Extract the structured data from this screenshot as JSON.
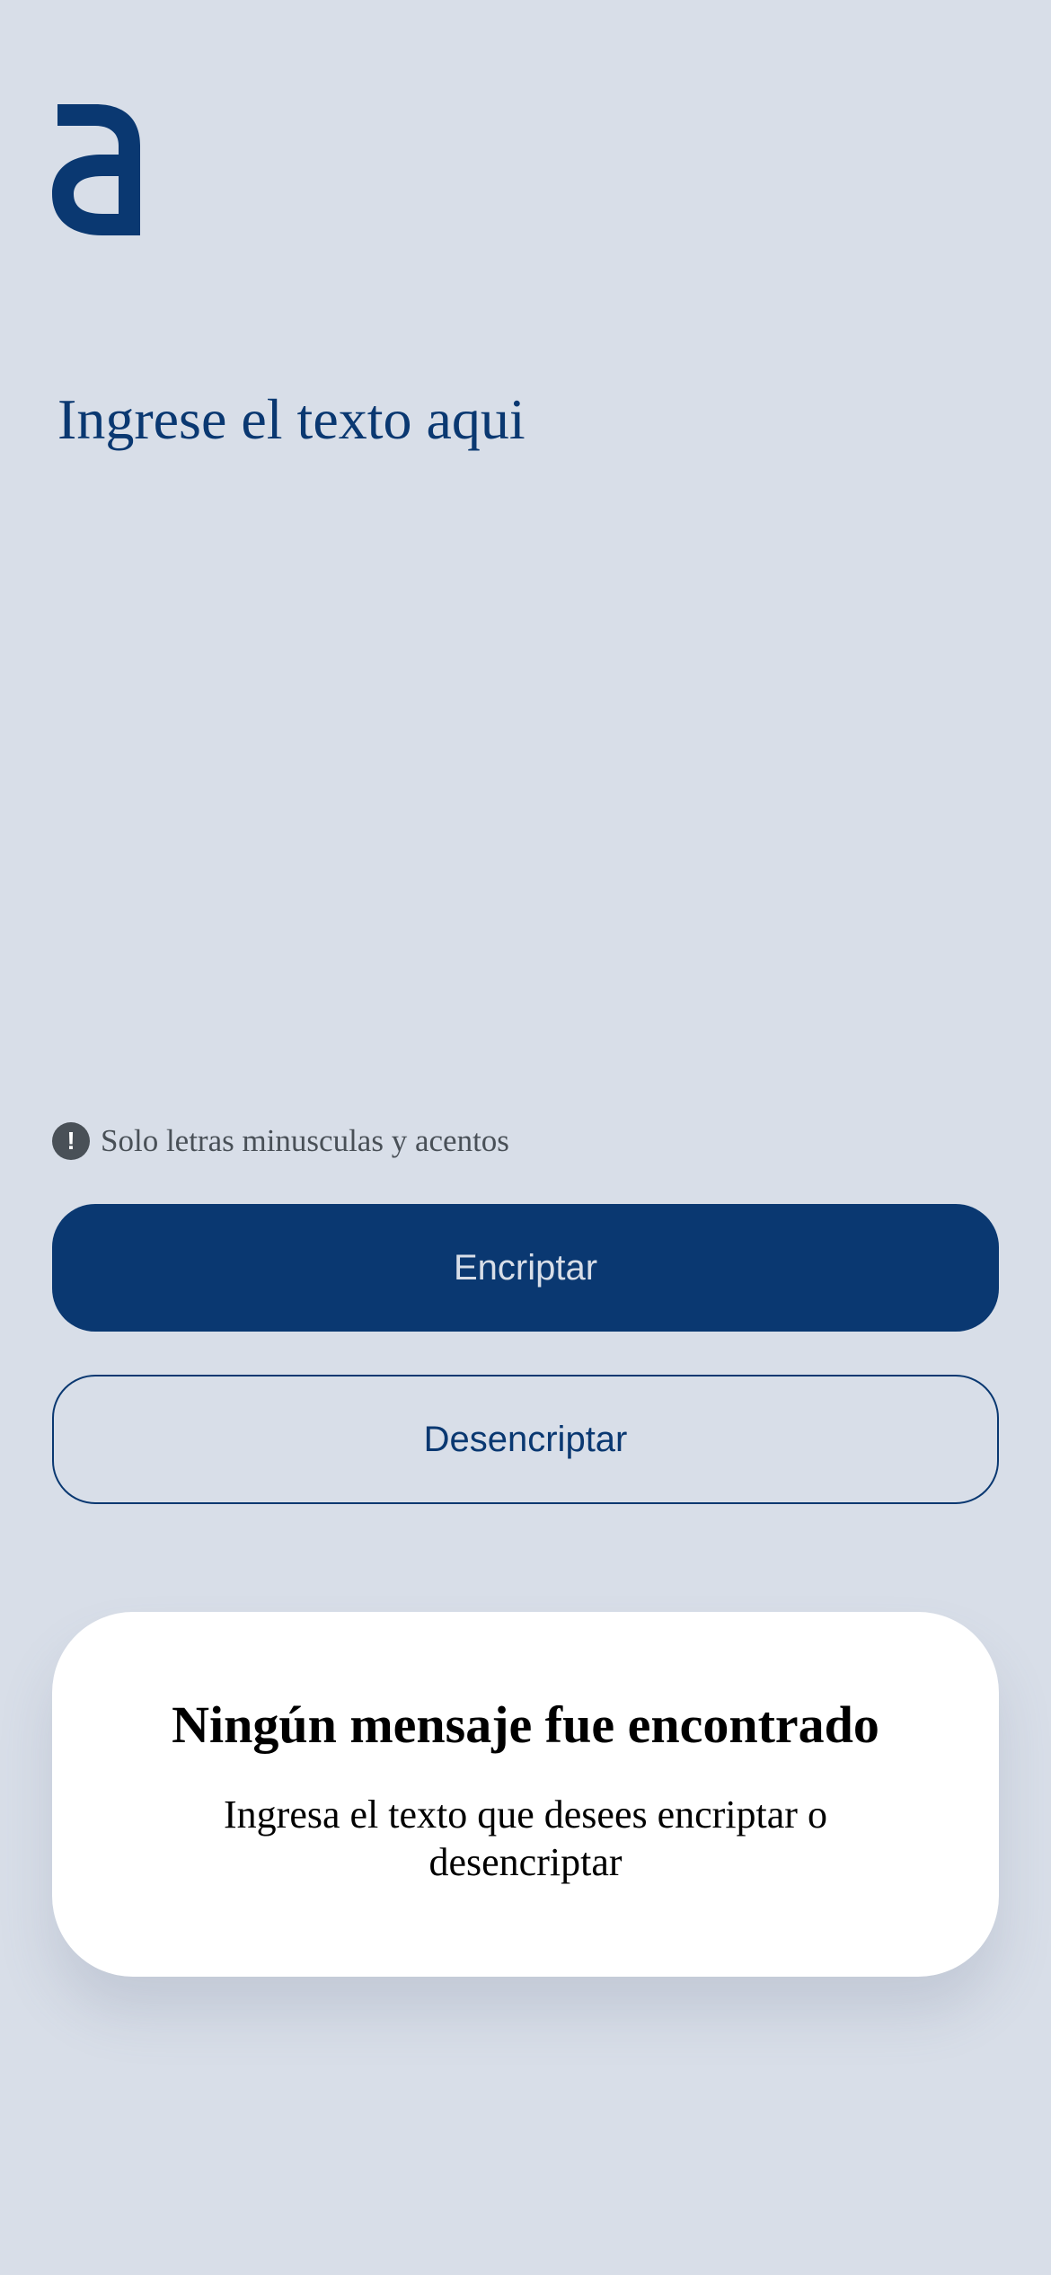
{
  "brand": {
    "logo_icon": "alura-a-logo-icon",
    "color": "#0a3871"
  },
  "input": {
    "placeholder": "Ingrese el texto aqui",
    "value": ""
  },
  "hint": {
    "icon": "exclamation-circle-icon",
    "text": "Solo letras minusculas y acentos"
  },
  "buttons": {
    "encrypt_label": "Encriptar",
    "decrypt_label": "Desencriptar"
  },
  "result": {
    "title": "Ningún mensaje fue encontrado",
    "message": "Ingresa el texto que desees encriptar o desencriptar"
  },
  "colors": {
    "background": "#d8dee8",
    "primary": "#0a3871",
    "hint_gray": "#495057",
    "card": "#ffffff"
  }
}
